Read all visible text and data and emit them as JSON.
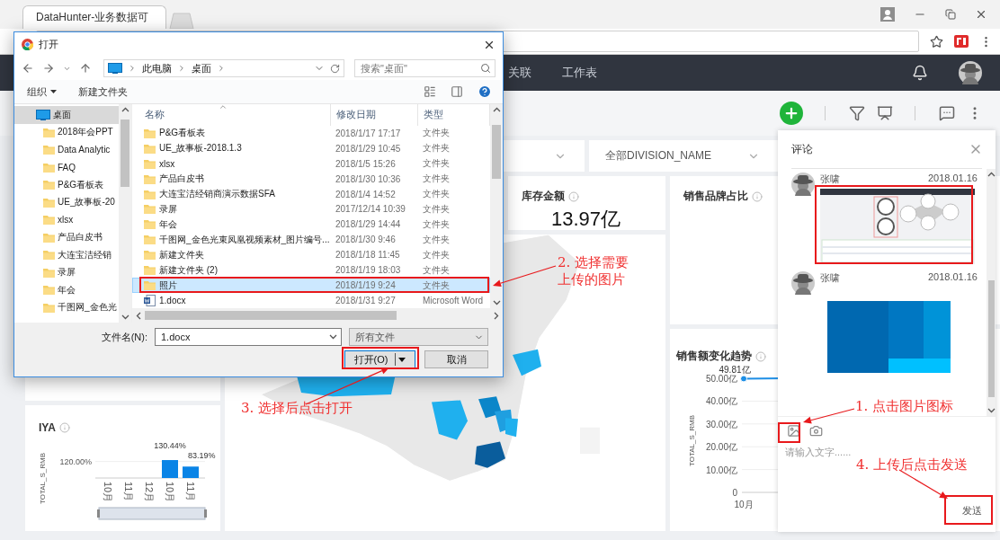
{
  "browser": {
    "tab_title": "DataHunter-业务数据可"
  },
  "app_header": {
    "nav": [
      {
        "label": "关联"
      },
      {
        "label": "工作表"
      }
    ]
  },
  "filters": [
    {
      "label": "全部DIVISION_NAME"
    }
  ],
  "kpi_card": {
    "title": "库存金额",
    "value": "13.97亿"
  },
  "brand_card": {
    "title": "销售品牌占比"
  },
  "trend_card": {
    "title": "销售额变化趋势",
    "chart_data": {
      "type": "line",
      "ylabel": "TOTAL_S_RMB",
      "categories": [
        "10月"
      ],
      "series": [
        {
          "color": "#1e8fe6",
          "marker": true,
          "values": [
            49.81
          ]
        }
      ],
      "ylim": [
        0,
        50
      ],
      "grid": true,
      "yticks": [
        {
          "value": 0,
          "label": "0"
        },
        {
          "value": 10,
          "label": "10.00亿"
        },
        {
          "value": 20,
          "label": "20.00亿"
        },
        {
          "value": 30,
          "label": "30.00亿"
        },
        {
          "value": 40,
          "label": "40.00亿"
        },
        {
          "value": 50,
          "label": "50.00亿"
        }
      ],
      "value_labels": [
        "49.81亿"
      ]
    }
  },
  "iya_card": {
    "title": "IYA",
    "ytick_label": "120.00%",
    "chart_data": {
      "type": "bar",
      "ylabel": "TOTAL_S_RMB",
      "categories": [
        "10月",
        "11月",
        "12月",
        "10月",
        "11月"
      ],
      "values": [
        null,
        null,
        null,
        130.44,
        83.19
      ],
      "value_labels": [
        null,
        null,
        null,
        "130.44%",
        "83.19%"
      ]
    }
  },
  "dialog": {
    "title": "打开",
    "breadcrumb": [
      {
        "label": "此电脑"
      },
      {
        "label": "桌面"
      }
    ],
    "search": {
      "placeholder": "搜索\"桌面\""
    },
    "toolbar": [
      {
        "label": "组织",
        "kind": "menu"
      },
      {
        "label": "新建文件夹",
        "kind": "button"
      }
    ],
    "tree": [
      {
        "label": "桌面",
        "kind": "desktop",
        "selected": true
      },
      {
        "label": "2018年会PPT",
        "kind": "folder",
        "selected": false
      },
      {
        "label": "Data Analytic",
        "kind": "folder",
        "selected": false
      },
      {
        "label": "FAQ",
        "kind": "folder",
        "selected": false
      },
      {
        "label": "P&G看板表",
        "kind": "folder",
        "selected": false
      },
      {
        "label": "UE_故事板-20",
        "kind": "folder",
        "selected": false
      },
      {
        "label": "xlsx",
        "kind": "folder",
        "selected": false
      },
      {
        "label": "产品白皮书",
        "kind": "folder",
        "selected": false
      },
      {
        "label": "大连宝洁经销",
        "kind": "folder",
        "selected": false
      },
      {
        "label": "录屏",
        "kind": "folder",
        "selected": false
      },
      {
        "label": "年会",
        "kind": "folder",
        "selected": false
      },
      {
        "label": "千图网_金色光",
        "kind": "folder",
        "selected": false
      }
    ],
    "columns": [
      {
        "label": "名称"
      },
      {
        "label": "修改日期"
      },
      {
        "label": "类型"
      }
    ],
    "files": [
      {
        "name": "P&G看板表",
        "date": "2018/1/17 17:17",
        "type": "文件夹",
        "kind": "folder",
        "selected": false
      },
      {
        "name": "UE_故事板-2018.1.3",
        "date": "2018/1/29 10:45",
        "type": "文件夹",
        "kind": "folder",
        "selected": false
      },
      {
        "name": "xlsx",
        "date": "2018/1/5 15:26",
        "type": "文件夹",
        "kind": "folder",
        "selected": false
      },
      {
        "name": "产品白皮书",
        "date": "2018/1/30 10:36",
        "type": "文件夹",
        "kind": "folder",
        "selected": false
      },
      {
        "name": "大连宝洁经销商演示数据SFA",
        "date": "2018/1/4 14:52",
        "type": "文件夹",
        "kind": "folder",
        "selected": false
      },
      {
        "name": "录屏",
        "date": "2017/12/14 10:39",
        "type": "文件夹",
        "kind": "folder",
        "selected": false
      },
      {
        "name": "年会",
        "date": "2018/1/29 14:44",
        "type": "文件夹",
        "kind": "folder",
        "selected": false
      },
      {
        "name": "千图网_金色光束凤凰视频素材_图片编号...",
        "date": "2018/1/30 9:46",
        "type": "文件夹",
        "kind": "folder",
        "selected": false
      },
      {
        "name": "新建文件夹",
        "date": "2018/1/18 11:45",
        "type": "文件夹",
        "kind": "folder",
        "selected": false
      },
      {
        "name": "新建文件夹 (2)",
        "date": "2018/1/19 18:03",
        "type": "文件夹",
        "kind": "folder",
        "selected": false
      },
      {
        "name": "照片",
        "date": "2018/1/19 9:24",
        "type": "文件夹",
        "kind": "folder",
        "selected": true
      },
      {
        "name": "1.docx",
        "date": "2018/1/31 9:27",
        "type": "Microsoft Word",
        "kind": "doc",
        "selected": false
      }
    ],
    "file_name": {
      "label": "文件名(N):",
      "value": "1.docx"
    },
    "file_type": {
      "value": "所有文件"
    },
    "buttons": [
      {
        "label": "打开(O)",
        "kind": "split"
      },
      {
        "label": "取消",
        "kind": "plain"
      }
    ]
  },
  "comments_panel": {
    "title": "评论",
    "comments": [
      {
        "author": "张啸",
        "date": "2018.01.16"
      },
      {
        "author": "张啸",
        "date": "2018.01.16"
      }
    ],
    "input": {
      "placeholder": "请输入文字......"
    },
    "send": {
      "label": "发送"
    }
  },
  "annotations": {
    "notes": [
      {
        "lines": [
          "2. 选择需要",
          "上传的图片"
        ]
      },
      {
        "lines": [
          "3. 选择后点击打开"
        ]
      },
      {
        "lines": [
          "1. 点击图片图标"
        ]
      },
      {
        "lines": [
          "4. 上传后点击发送"
        ]
      }
    ]
  }
}
